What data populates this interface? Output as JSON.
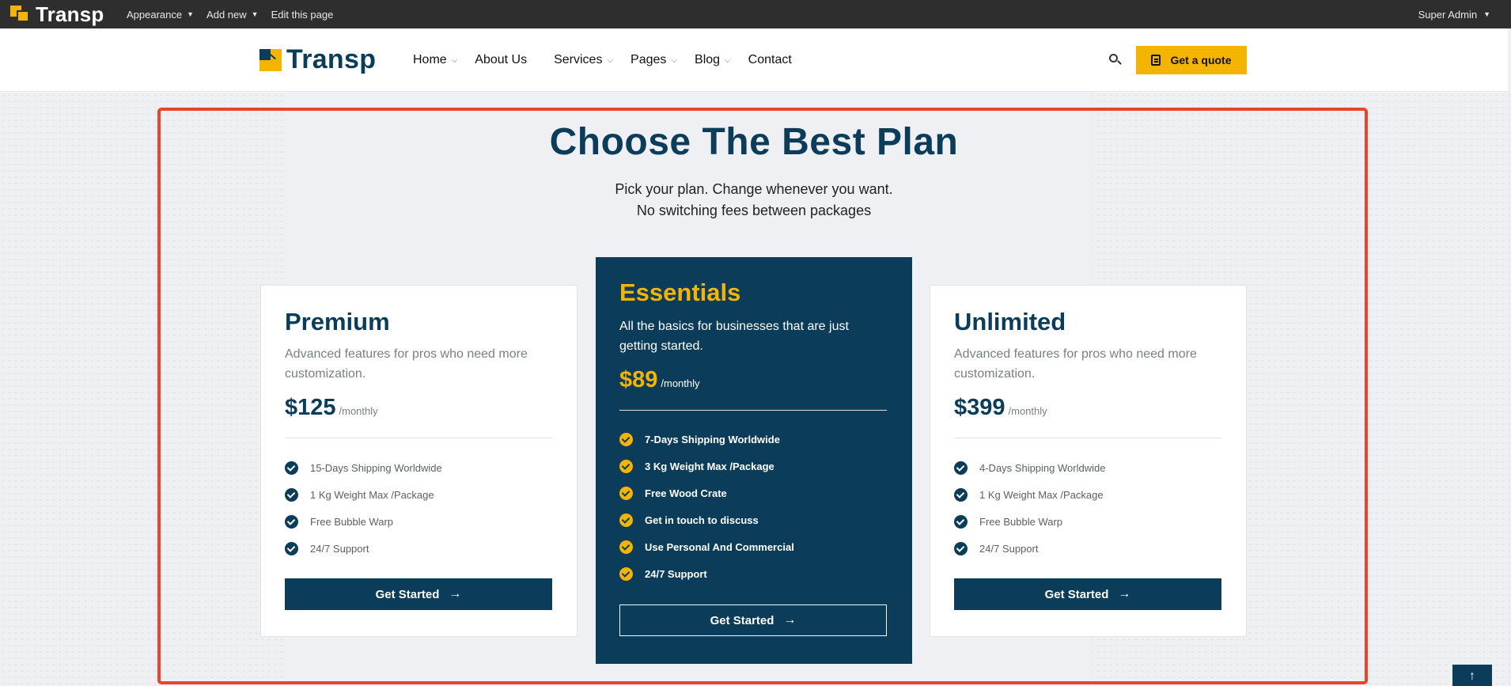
{
  "admin_bar": {
    "logo_text": "Transp",
    "menu": [
      {
        "label": "Appearance",
        "has_dropdown": true
      },
      {
        "label": "Add new",
        "has_dropdown": true
      },
      {
        "label": "Edit this page",
        "has_dropdown": false
      }
    ],
    "user": "Super Admin"
  },
  "header": {
    "logo_text": "Transp",
    "nav": [
      {
        "label": "Home",
        "has_dropdown": true
      },
      {
        "label": "About Us",
        "has_dropdown": false
      },
      {
        "label": "Services",
        "has_dropdown": true
      },
      {
        "label": "Pages",
        "has_dropdown": true
      },
      {
        "label": "Blog",
        "has_dropdown": true
      },
      {
        "label": "Contact",
        "has_dropdown": false
      }
    ],
    "search_icon": "search-icon",
    "quote_button": "Get a quote"
  },
  "pricing": {
    "title": "Choose The Best Plan",
    "subtitle_line1": "Pick your plan. Change whenever you want.",
    "subtitle_line2": "No switching fees between packages",
    "plans": [
      {
        "name": "Premium",
        "description": "Advanced features for pros who need more customization.",
        "price": "$125",
        "period": "/monthly",
        "features": [
          "15-Days Shipping Worldwide",
          "1 Kg Weight Max /Package",
          "Free Bubble Warp",
          "24/7 Support"
        ],
        "button": "Get Started",
        "featured": false
      },
      {
        "name": "Essentials",
        "description": "All the basics for businesses that are just getting started.",
        "price": "$89",
        "period": "/monthly",
        "features": [
          "7-Days Shipping Worldwide",
          "3 Kg Weight Max /Package",
          "Free Wood Crate",
          "Get in touch to discuss",
          "Use Personal And Commercial",
          "24/7 Support"
        ],
        "button": "Get Started",
        "featured": true
      },
      {
        "name": "Unlimited",
        "description": "Advanced features for pros who need more customization.",
        "price": "$399",
        "period": "/monthly",
        "features": [
          "4-Days Shipping Worldwide",
          "1 Kg Weight Max /Package",
          "Free Bubble Warp",
          "24/7 Support"
        ],
        "button": "Get Started",
        "featured": false
      }
    ]
  },
  "colors": {
    "brand_navy": "#0b3d5b",
    "brand_yellow": "#f4b400",
    "highlight_outline": "#e8452c",
    "admin_bar": "#2e2e2e"
  }
}
